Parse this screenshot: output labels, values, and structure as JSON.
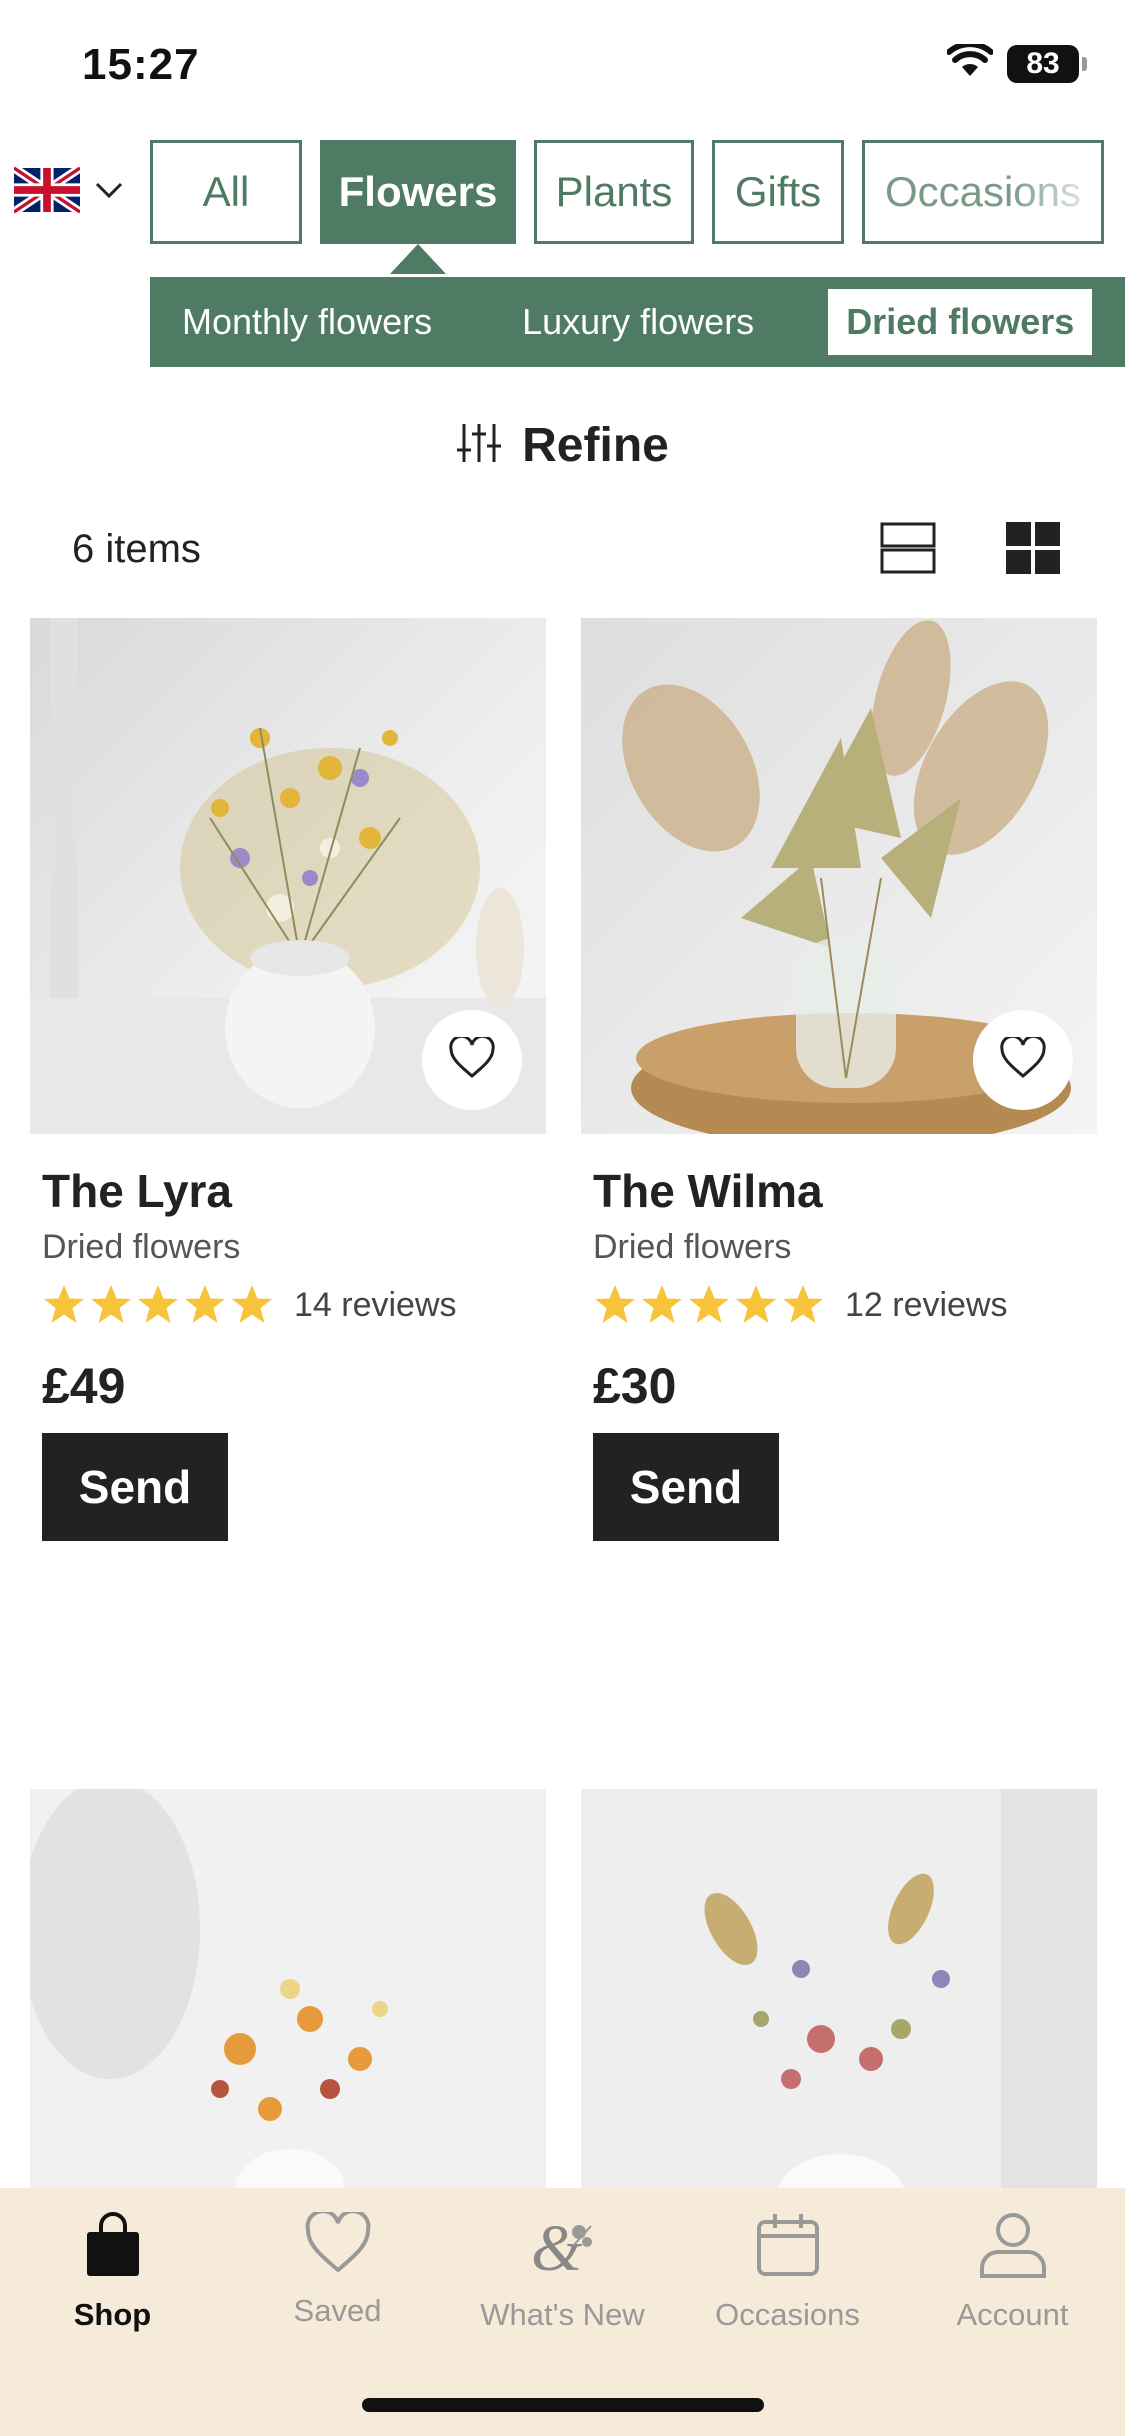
{
  "status_bar": {
    "time": "15:27",
    "battery": "83"
  },
  "locale": {
    "flag": "uk-flag-icon",
    "chevron": "chevron-down-icon"
  },
  "category_tabs": [
    "All",
    "Flowers",
    "Plants",
    "Gifts",
    "Occasions"
  ],
  "active_category": "Flowers",
  "subcategories": [
    "Monthly flowers",
    "Luxury flowers",
    "Dried flowers"
  ],
  "active_subcategory": "Dried flowers",
  "refine": {
    "label": "Refine",
    "icon": "sliders-icon"
  },
  "listing": {
    "count_label": "6 items",
    "list_view_icon": "list-view-icon",
    "grid_view_icon": "grid-view-icon"
  },
  "products": [
    {
      "name": "The Lyra",
      "type": "Dried flowers",
      "rating": 5,
      "reviews": "14 reviews",
      "price": "£49",
      "cta": "Send",
      "icon": "heart-icon"
    },
    {
      "name": "The Wilma",
      "type": "Dried flowers",
      "rating": 5,
      "reviews": "12 reviews",
      "price": "£30",
      "cta": "Send",
      "icon": "heart-icon"
    }
  ],
  "tab_bar": [
    {
      "label": "Shop",
      "icon": "shopping-bag-icon",
      "active": true
    },
    {
      "label": "Saved",
      "icon": "heart-icon",
      "active": false
    },
    {
      "label": "What's New",
      "icon": "ampersand-floral-icon",
      "active": false
    },
    {
      "label": "Occasions",
      "icon": "calendar-icon",
      "active": false
    },
    {
      "label": "Account",
      "icon": "person-icon",
      "active": false
    }
  ],
  "colors": {
    "brand_green": "#4f7a63",
    "star_yellow": "#f7c33a",
    "tabbar_bg": "#f6ead8",
    "button_dark": "#222222"
  }
}
